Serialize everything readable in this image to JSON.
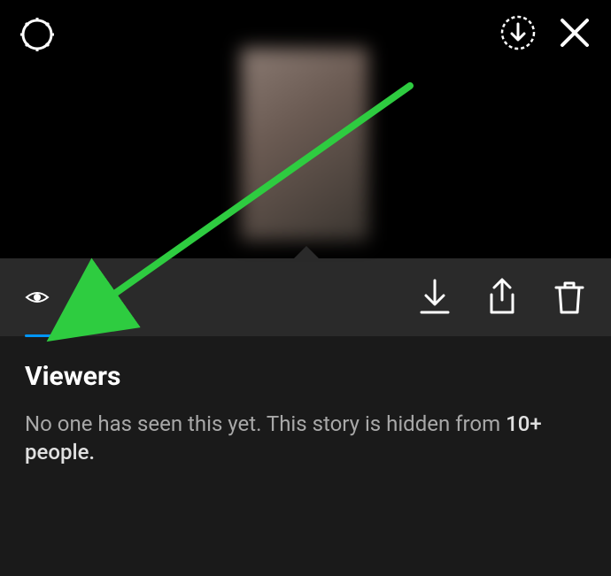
{
  "icons": {
    "settings": "settings-gear",
    "capture": "circle-download",
    "close": "close-x",
    "eye": "viewers-eye",
    "download": "download-arrow",
    "share": "share-upload",
    "delete": "trash"
  },
  "viewers": {
    "title": "Viewers",
    "message_prefix": "No one has seen this yet. This story is hidden from ",
    "message_highlight": "10+ people."
  },
  "annotation": {
    "arrow_color": "#2ecc40"
  }
}
